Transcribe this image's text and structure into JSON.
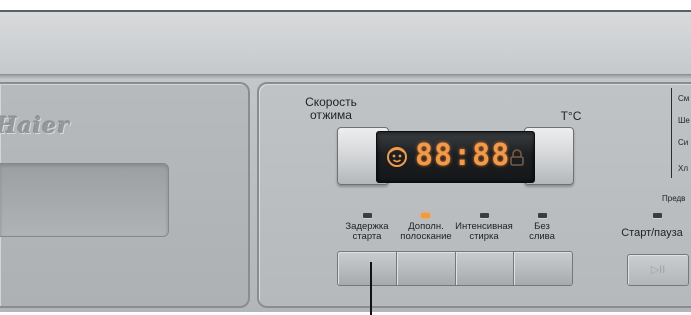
{
  "brand": "Haier",
  "spin": {
    "line1": "Скорость",
    "line2": "отжима"
  },
  "temperature_label": "T°C",
  "display": {
    "digits": "88:88"
  },
  "side_programs": [
    "См",
    "Ше",
    "Си",
    "Хл"
  ],
  "delay_indicator_partial": "Предв",
  "options": [
    {
      "line1": "Задержка",
      "line2": "старта",
      "led_on": false
    },
    {
      "line1": "Дополн.",
      "line2": "полоскание",
      "led_on": true
    },
    {
      "line1": "Интенсивная",
      "line2": "стирка",
      "led_on": false
    },
    {
      "line1": "Без",
      "line2": "слива",
      "led_on": false
    }
  ],
  "start_pause": {
    "label": "Старт/пауза",
    "icon_text": "▷II"
  },
  "colors": {
    "panel": "#bfc2c5",
    "led_active": "#f59a3c",
    "display_digits": "#f19a4a"
  }
}
